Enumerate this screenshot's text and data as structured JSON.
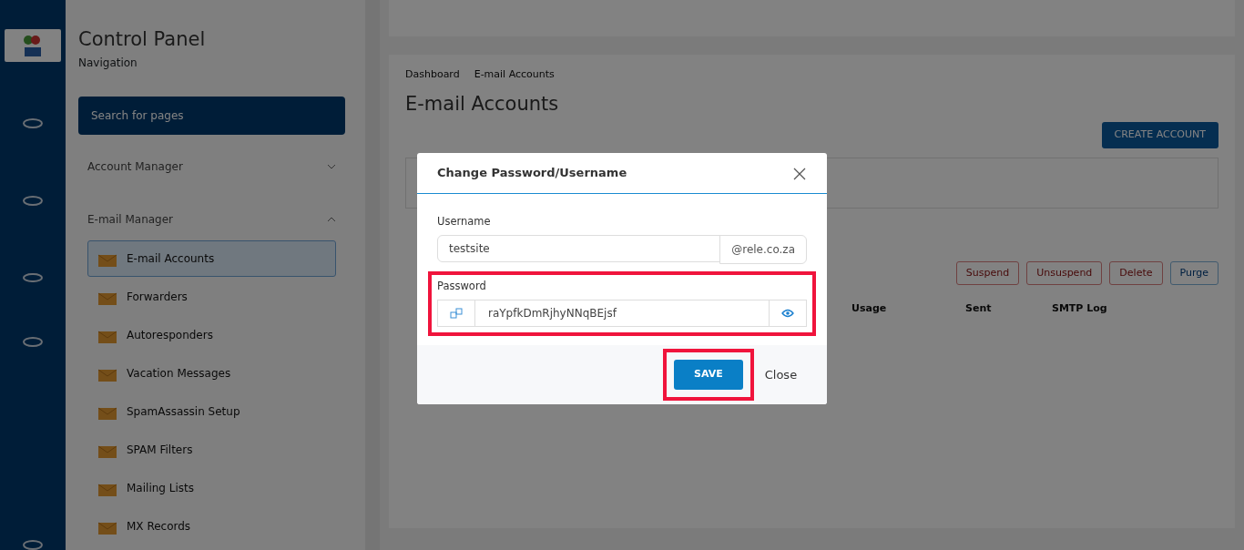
{
  "sidebar": {
    "title": "Control Panel",
    "subtitle": "Navigation",
    "search": {
      "placeholder": "Search for pages"
    },
    "sections": [
      {
        "label": "Account Manager",
        "expanded": false
      },
      {
        "label": "E-mail Manager",
        "expanded": true,
        "items": [
          {
            "label": "E-mail Accounts",
            "selected": true
          },
          {
            "label": "Forwarders",
            "selected": false
          },
          {
            "label": "Autoresponders",
            "selected": false
          },
          {
            "label": "Vacation Messages",
            "selected": false
          },
          {
            "label": "SpamAssassin Setup",
            "selected": false
          },
          {
            "label": "SPAM Filters",
            "selected": false
          },
          {
            "label": "Mailing Lists",
            "selected": false
          },
          {
            "label": "MX Records",
            "selected": false
          }
        ]
      }
    ]
  },
  "main": {
    "breadcrumb": [
      "Dashboard",
      "E-mail Accounts"
    ],
    "title": "E-mail Accounts",
    "actions": [
      "CREATE ACCOUNT"
    ],
    "bulk_actions": [
      {
        "label": "Suspend",
        "kind": "danger"
      },
      {
        "label": "Unsuspend",
        "kind": "danger"
      },
      {
        "label": "Delete",
        "kind": "danger"
      },
      {
        "label": "Purge",
        "kind": "primary"
      }
    ],
    "table": {
      "columns": [
        "Usage",
        "Sent",
        "SMTP Log"
      ]
    }
  },
  "dialog": {
    "title": "Change Password/Username",
    "username": {
      "label": "Username",
      "value": "testsite",
      "domain": "@rele.co.za"
    },
    "password": {
      "label": "Password",
      "value": "raYpfkDmRjhyNNqBEjsf",
      "highlighted": true
    },
    "save": {
      "label": "SAVE",
      "highlighted": true
    },
    "close": "Close"
  }
}
